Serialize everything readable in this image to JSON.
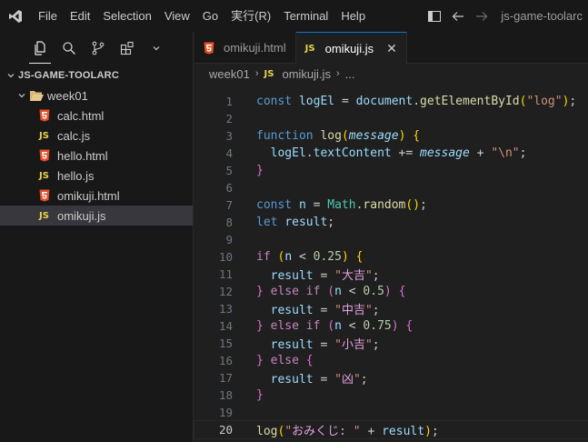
{
  "menu": [
    "File",
    "Edit",
    "Selection",
    "View",
    "Go",
    "実行(R)",
    "Terminal",
    "Help"
  ],
  "window_title": "js-game-toolarc",
  "explorer": {
    "section_title": "JS-GAME-TOOLARC",
    "folder": "week01",
    "files": [
      {
        "name": "calc.html",
        "type": "html"
      },
      {
        "name": "calc.js",
        "type": "js"
      },
      {
        "name": "hello.html",
        "type": "html"
      },
      {
        "name": "hello.js",
        "type": "js"
      },
      {
        "name": "omikuji.html",
        "type": "html"
      },
      {
        "name": "omikuji.js",
        "type": "js",
        "selected": true
      }
    ]
  },
  "tabs": [
    {
      "label": "omikuji.html",
      "type": "html",
      "active": false
    },
    {
      "label": "omikuji.js",
      "type": "js",
      "active": true
    }
  ],
  "breadcrumb": {
    "folder": "week01",
    "file": "omikuji.js",
    "symbol": "..."
  },
  "code": {
    "current_line": 20,
    "lines": [
      "const logEl = document.getElementById(\"log\");",
      "",
      "function log(message) {",
      "  logEl.textContent += message + \"\\n\";",
      "}",
      "",
      "const n = Math.random();",
      "let result;",
      "",
      "if (n < 0.25) {",
      "  result = \"大吉\";",
      "} else if (n < 0.5) {",
      "  result = \"中吉\";",
      "} else if (n < 0.75) {",
      "  result = \"小吉\";",
      "} else {",
      "  result = \"凶\";",
      "}",
      "",
      "log(\"おみくじ: \" + result);"
    ]
  },
  "colors": {
    "accent": "#0078d4",
    "html_icon": "#e44d26",
    "js_icon": "#e8d44d"
  }
}
